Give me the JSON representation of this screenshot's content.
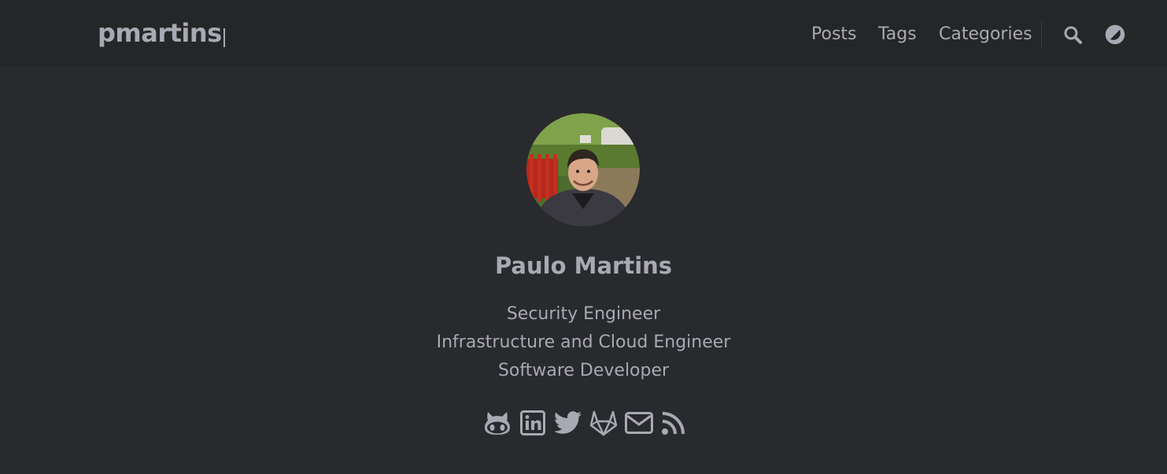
{
  "header": {
    "logo_text": "pmartins",
    "nav": {
      "items": [
        {
          "label": "Posts"
        },
        {
          "label": "Tags"
        },
        {
          "label": "Categories"
        }
      ],
      "search_icon": "search-icon",
      "theme_icon": "theme-toggle-icon"
    }
  },
  "profile": {
    "name": "Paulo Martins",
    "roles": [
      "Security Engineer",
      "Infrastructure and Cloud Engineer",
      "Software Developer"
    ],
    "avatar_icon": "avatar-photo",
    "socials": [
      {
        "icon": "github-icon"
      },
      {
        "icon": "linkedin-icon"
      },
      {
        "icon": "twitter-icon"
      },
      {
        "icon": "gitlab-icon"
      },
      {
        "icon": "email-icon"
      },
      {
        "icon": "rss-icon"
      }
    ]
  },
  "colors": {
    "background": "#292a2d",
    "header_background": "#252627",
    "text": "#a9a9b3"
  }
}
